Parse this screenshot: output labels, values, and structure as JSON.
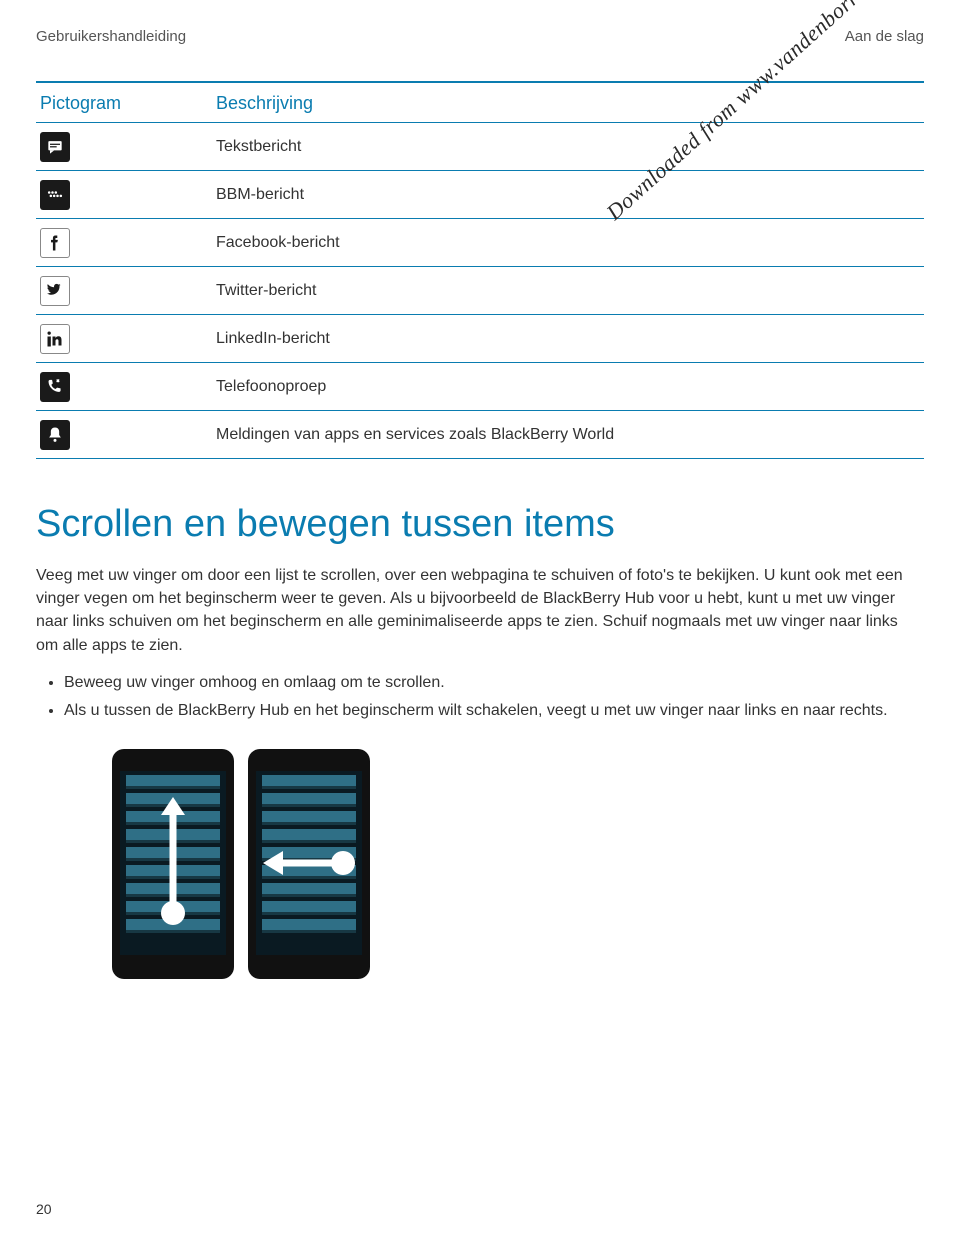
{
  "header": {
    "left": "Gebruikershandleiding",
    "right": "Aan de slag"
  },
  "watermark": "Downloaded from www.vandenborre.be",
  "table": {
    "head_icon": "Pictogram",
    "head_desc": "Beschrijving",
    "rows": [
      {
        "icon": "text-message-icon",
        "desc": "Tekstbericht"
      },
      {
        "icon": "bbm-icon",
        "desc": "BBM-bericht"
      },
      {
        "icon": "facebook-icon",
        "desc": "Facebook-bericht"
      },
      {
        "icon": "twitter-icon",
        "desc": "Twitter-bericht"
      },
      {
        "icon": "linkedin-icon",
        "desc": "LinkedIn-bericht"
      },
      {
        "icon": "phone-call-icon",
        "desc": "Telefoonoproep"
      },
      {
        "icon": "bell-icon",
        "desc": "Meldingen van apps en services zoals BlackBerry World"
      }
    ]
  },
  "section_heading": "Scrollen en bewegen tussen items",
  "paragraph": "Veeg met uw vinger om door een lijst te scrollen, over een webpagina te schuiven of foto's te bekijken. U kunt ook met een vinger vegen om het beginscherm weer te geven. Als u bijvoorbeeld de BlackBerry Hub voor u hebt, kunt u met uw vinger naar links schuiven om het beginscherm en alle geminimaliseerde apps te zien. Schuif nogmaals met uw vinger naar links om alle apps te zien.",
  "bullets": [
    "Beweeg uw vinger omhoog en omlaag om te scrollen.",
    "Als u tussen de BlackBerry Hub en het beginscherm wilt schakelen, veegt u met uw vinger naar links en naar rechts."
  ],
  "page_number": "20"
}
